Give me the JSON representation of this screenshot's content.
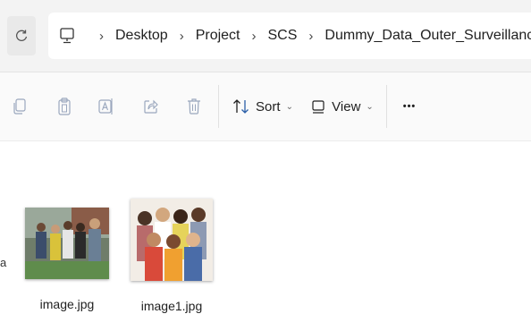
{
  "address_bar": {
    "breadcrumbs": [
      "Desktop",
      "Project",
      "SCS",
      "Dummy_Data_Outer_Surveillance"
    ]
  },
  "toolbar": {
    "sort_label": "Sort",
    "view_label": "View",
    "more_label": "•••"
  },
  "files": [
    {
      "name": "image.jpg"
    },
    {
      "name": "image1.jpg"
    }
  ],
  "content": {
    "edge_letter": "a"
  },
  "colors": {
    "address_background": "#f3f3f3",
    "toolbar_background": "#fafafa",
    "disabled_icon": "#9aa7bd",
    "sort_arrow_accent": "#2b5fa8"
  }
}
